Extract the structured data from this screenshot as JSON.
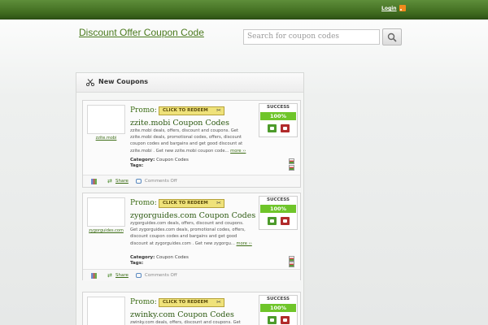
{
  "header": {
    "login_label": "Login",
    "rss_icon": "rss-icon",
    "site_title": "Discount Offer Coupon Code",
    "search_placeholder": "Search for coupon codes"
  },
  "panel": {
    "title": "New Coupons"
  },
  "labels": {
    "promo": "Promo:",
    "redeem": "CLICK TO REDEEM",
    "success": "SUCCESS",
    "category": "Category:",
    "tags": "Tags:",
    "share": "Share",
    "comments": "Comments Off"
  },
  "coupons": [
    {
      "thumb_link": "zzite.mobi",
      "title": "zzite.mobi Coupon Codes",
      "description": "zzite.mobi deals, offers, discount and coupons. Get zzite.mobi deals, promotional codes, offers, discount coupon codes and bargains and get good discount at zzite.mobi . Get new zzite.mobi coupon code...",
      "more": "more ››",
      "category": "Coupon Codes",
      "success_pct": "100%"
    },
    {
      "thumb_link": "zygorguides.com",
      "title": "zygorguides.com Coupon Codes",
      "description": "zygorguides.com deals, offers, discount and coupons. Get zygorguides.com deals, promotional codes, offers, discount coupon codes and bargains and get good discount at zygorguides.com . Get new zygorgu...",
      "more": "more ››",
      "category": "Coupon Codes",
      "success_pct": "100%"
    },
    {
      "thumb_link": "",
      "title": "zwinky.com Coupon Codes",
      "description": "zwinky.com deals, offers, discount and coupons. Get",
      "more": "",
      "category": "",
      "success_pct": "100%"
    }
  ]
}
